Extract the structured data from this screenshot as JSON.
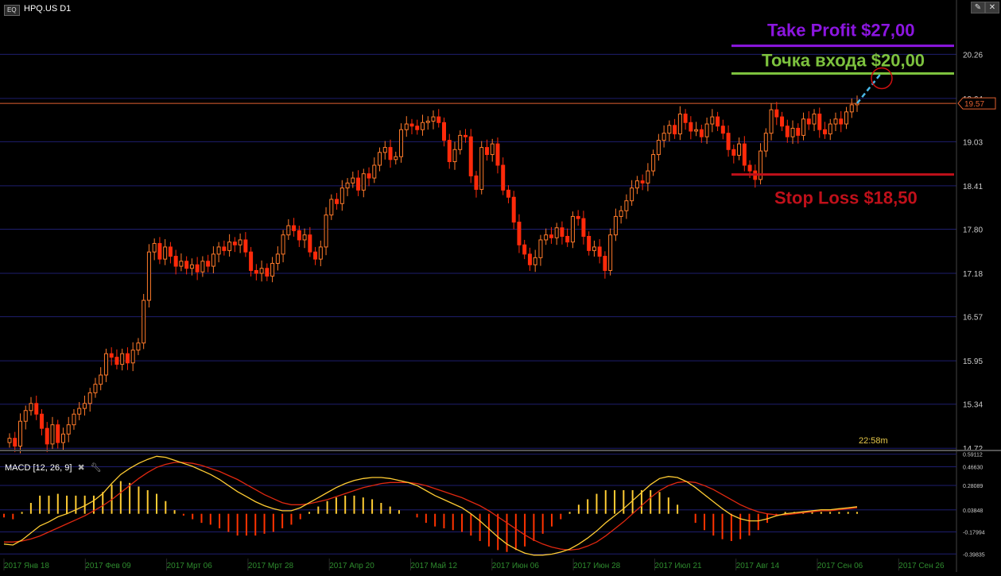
{
  "window": {
    "eq_badge": "EQ",
    "symbol": "HPQ.US D1",
    "timer": "22:58m",
    "macd_label": "MACD [12, 26, 9]",
    "macd_tool_icons": [
      "close-icon",
      "wrench-icon"
    ],
    "top_buttons": [
      "edit-icon",
      "close-icon"
    ]
  },
  "colors": {
    "background": "#000000",
    "bull_candle": "#ff7a2a",
    "bear_candle": "#ff2a0a",
    "grid": "#1e1e6e",
    "take_profit": "#8c16e0",
    "entry": "#7dc23e",
    "stop_loss": "#c0101a",
    "current_price": "#e06030",
    "macd_line": "#ffcc33",
    "signal_line": "#e02810",
    "hist_pos": "#ffcc33",
    "hist_neg": "#ff3300",
    "axis_text": "#cccccc",
    "date_text": "#2e8b2e"
  },
  "annotations": {
    "take_profit": {
      "label": "Take Profit $27,00",
      "line_price": 20.38
    },
    "entry": {
      "label": "Точка входа $20,00",
      "line_price": 19.99
    },
    "stop_loss": {
      "label": "Stop Loss $18,50",
      "line_price": 18.57
    },
    "current_price_label": "19.57"
  },
  "chart_data": [
    {
      "type": "candlestick",
      "y_ticks": [
        "20.26",
        "19.64",
        "19.03",
        "18.41",
        "17.80",
        "17.18",
        "16.57",
        "15.95",
        "15.34",
        "14.72"
      ],
      "ylim": [
        14.7,
        20.8
      ],
      "current_price": 19.57,
      "x_tick_labels": [
        "2017 Янв 18",
        "2017 Фев 09",
        "2017 Мрт 06",
        "2017 Мрт 28",
        "2017 Апр 20",
        "2017 Май 12",
        "2017 Июн 06",
        "2017 Июн 28",
        "2017 Июл 21",
        "2017 Авг 14",
        "2017 Сен 06",
        "2017 Сен 26"
      ],
      "closes": [
        14.86,
        14.75,
        15.1,
        15.25,
        15.35,
        15.2,
        15.0,
        14.78,
        15.05,
        14.8,
        14.92,
        15.05,
        15.2,
        15.28,
        15.35,
        15.5,
        15.62,
        15.75,
        16.05,
        16.0,
        15.9,
        16.05,
        15.92,
        16.1,
        16.2,
        16.8,
        17.48,
        17.6,
        17.38,
        17.55,
        17.42,
        17.28,
        17.35,
        17.25,
        17.3,
        17.2,
        17.35,
        17.28,
        17.45,
        17.55,
        17.5,
        17.62,
        17.58,
        17.65,
        17.48,
        17.22,
        17.18,
        17.25,
        17.14,
        17.32,
        17.45,
        17.72,
        17.85,
        17.78,
        17.65,
        17.72,
        17.48,
        17.38,
        17.55,
        18.0,
        18.22,
        18.16,
        18.38,
        18.45,
        18.52,
        18.35,
        18.58,
        18.52,
        18.7,
        18.88,
        18.95,
        18.78,
        18.82,
        19.2,
        19.28,
        19.25,
        19.2,
        19.3,
        19.32,
        19.38,
        19.3,
        19.05,
        18.75,
        18.92,
        19.12,
        19.1,
        18.55,
        18.36,
        18.95,
        18.85,
        19.0,
        18.7,
        18.35,
        18.25,
        17.9,
        17.58,
        17.45,
        17.3,
        17.4,
        17.65,
        17.72,
        17.68,
        17.82,
        17.7,
        17.62,
        17.98,
        17.95,
        17.7,
        17.5,
        17.55,
        17.42,
        17.22,
        17.72,
        17.98,
        18.06,
        18.2,
        18.38,
        18.48,
        18.45,
        18.62,
        18.85,
        19.05,
        19.15,
        19.26,
        19.14,
        19.42,
        19.3,
        19.18,
        19.2,
        19.1,
        19.28,
        19.38,
        19.25,
        19.15,
        18.92,
        18.84,
        19.0,
        18.7,
        18.62,
        18.5,
        18.9,
        19.15,
        19.48,
        19.38,
        19.25,
        19.1,
        19.22,
        19.12,
        19.35,
        19.28,
        19.42,
        19.2,
        19.14,
        19.28,
        19.35,
        19.28,
        19.45,
        19.55,
        19.57
      ],
      "macd_yticks": [
        "0.59112",
        "0.46630",
        "0.28089",
        "0.03848",
        "-0.17994",
        "-0.39835"
      ],
      "macd_ylim": [
        -0.42,
        0.62
      ],
      "macd_line": [
        -0.3,
        -0.31,
        -0.26,
        -0.19,
        -0.12,
        -0.08,
        -0.03,
        0.0,
        0.04,
        0.08,
        0.13,
        0.2,
        0.3,
        0.39,
        0.45,
        0.5,
        0.54,
        0.57,
        0.56,
        0.53,
        0.5,
        0.47,
        0.43,
        0.39,
        0.34,
        0.28,
        0.22,
        0.17,
        0.12,
        0.08,
        0.05,
        0.03,
        0.03,
        0.06,
        0.11,
        0.16,
        0.21,
        0.26,
        0.3,
        0.33,
        0.35,
        0.36,
        0.36,
        0.35,
        0.33,
        0.31,
        0.28,
        0.23,
        0.18,
        0.14,
        0.1,
        0.06,
        0.0,
        -0.07,
        -0.15,
        -0.23,
        -0.3,
        -0.35,
        -0.39,
        -0.41,
        -0.41,
        -0.4,
        -0.38,
        -0.35,
        -0.3,
        -0.24,
        -0.17,
        -0.09,
        -0.02,
        0.05,
        0.13,
        0.21,
        0.29,
        0.35,
        0.37,
        0.36,
        0.32,
        0.26,
        0.19,
        0.12,
        0.05,
        -0.01,
        -0.05,
        -0.07,
        -0.07,
        -0.05,
        -0.02,
        0.0,
        0.01,
        0.02,
        0.03,
        0.04,
        0.04,
        0.05,
        0.06,
        0.07
      ],
      "signal_line": [
        -0.28,
        -0.28,
        -0.27,
        -0.25,
        -0.22,
        -0.18,
        -0.14,
        -0.1,
        -0.06,
        -0.02,
        0.03,
        0.08,
        0.14,
        0.21,
        0.28,
        0.35,
        0.41,
        0.46,
        0.49,
        0.51,
        0.51,
        0.5,
        0.48,
        0.45,
        0.42,
        0.38,
        0.34,
        0.29,
        0.24,
        0.19,
        0.15,
        0.11,
        0.09,
        0.09,
        0.1,
        0.12,
        0.14,
        0.17,
        0.2,
        0.23,
        0.26,
        0.28,
        0.3,
        0.31,
        0.31,
        0.31,
        0.3,
        0.28,
        0.25,
        0.22,
        0.19,
        0.16,
        0.12,
        0.08,
        0.03,
        -0.03,
        -0.09,
        -0.15,
        -0.21,
        -0.26,
        -0.3,
        -0.33,
        -0.35,
        -0.36,
        -0.35,
        -0.32,
        -0.28,
        -0.22,
        -0.15,
        -0.08,
        0.0,
        0.08,
        0.16,
        0.23,
        0.28,
        0.31,
        0.32,
        0.31,
        0.28,
        0.24,
        0.19,
        0.14,
        0.09,
        0.05,
        0.02,
        0.0,
        -0.01,
        -0.01,
        0.0,
        0.01,
        0.02,
        0.03,
        0.03,
        0.04,
        0.05,
        0.06
      ]
    }
  ]
}
